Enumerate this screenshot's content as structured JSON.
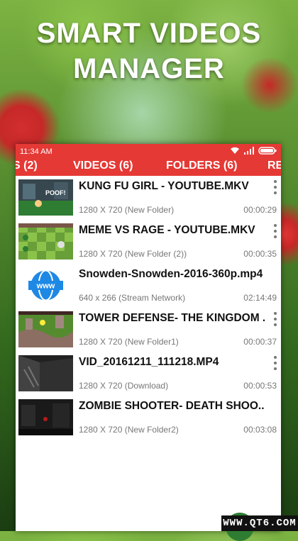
{
  "headline": {
    "line1": "SMART VIDEOS",
    "line2": "MANAGER"
  },
  "status_bar": {
    "time": "11:34 AM"
  },
  "tabs": [
    {
      "label": "S (2)"
    },
    {
      "label": "VIDEOS (6)",
      "active": true
    },
    {
      "label": "FOLDERS (6)"
    },
    {
      "label": "RE"
    }
  ],
  "videos": [
    {
      "title": "KUNG FU GIRL - YOUTUBE.MKV",
      "resolution": "1280 X 720",
      "folder": "(New Folder)",
      "duration": "00:00:29",
      "thumb": "game-scene"
    },
    {
      "title": "MEME VS RAGE - YOUTUBE.MKV",
      "resolution": "1280 X 720",
      "folder": "(New Folder (2))",
      "duration": "00:00:35",
      "thumb": "grid-game"
    },
    {
      "title": "Snowden-Snowden-2016-360p.mp4",
      "resolution": "640 x 266",
      "folder": "(Stream Network)",
      "duration": "02:14:49",
      "thumb": "www-globe-icon"
    },
    {
      "title": "TOWER DEFENSE- THE KINGDOM ...",
      "resolution": "1280 X 720",
      "folder": "(New Folder1)",
      "duration": "00:00:37",
      "thumb": "tower-defense"
    },
    {
      "title": "VID_20161211_111218.MP4",
      "resolution": "1280 X 720",
      "folder": "(Download)",
      "duration": "00:00:53",
      "thumb": "dark-room"
    },
    {
      "title": "ZOMBIE SHOOTER- DEATH SHOO...",
      "resolution": "1280 X 720",
      "folder": "(New Folder2)",
      "duration": "00:03:08",
      "thumb": "dark-scene"
    }
  ],
  "watermark": "WWW.QT6.COM",
  "colors": {
    "accent": "#e53935",
    "meta_text": "#777777"
  }
}
